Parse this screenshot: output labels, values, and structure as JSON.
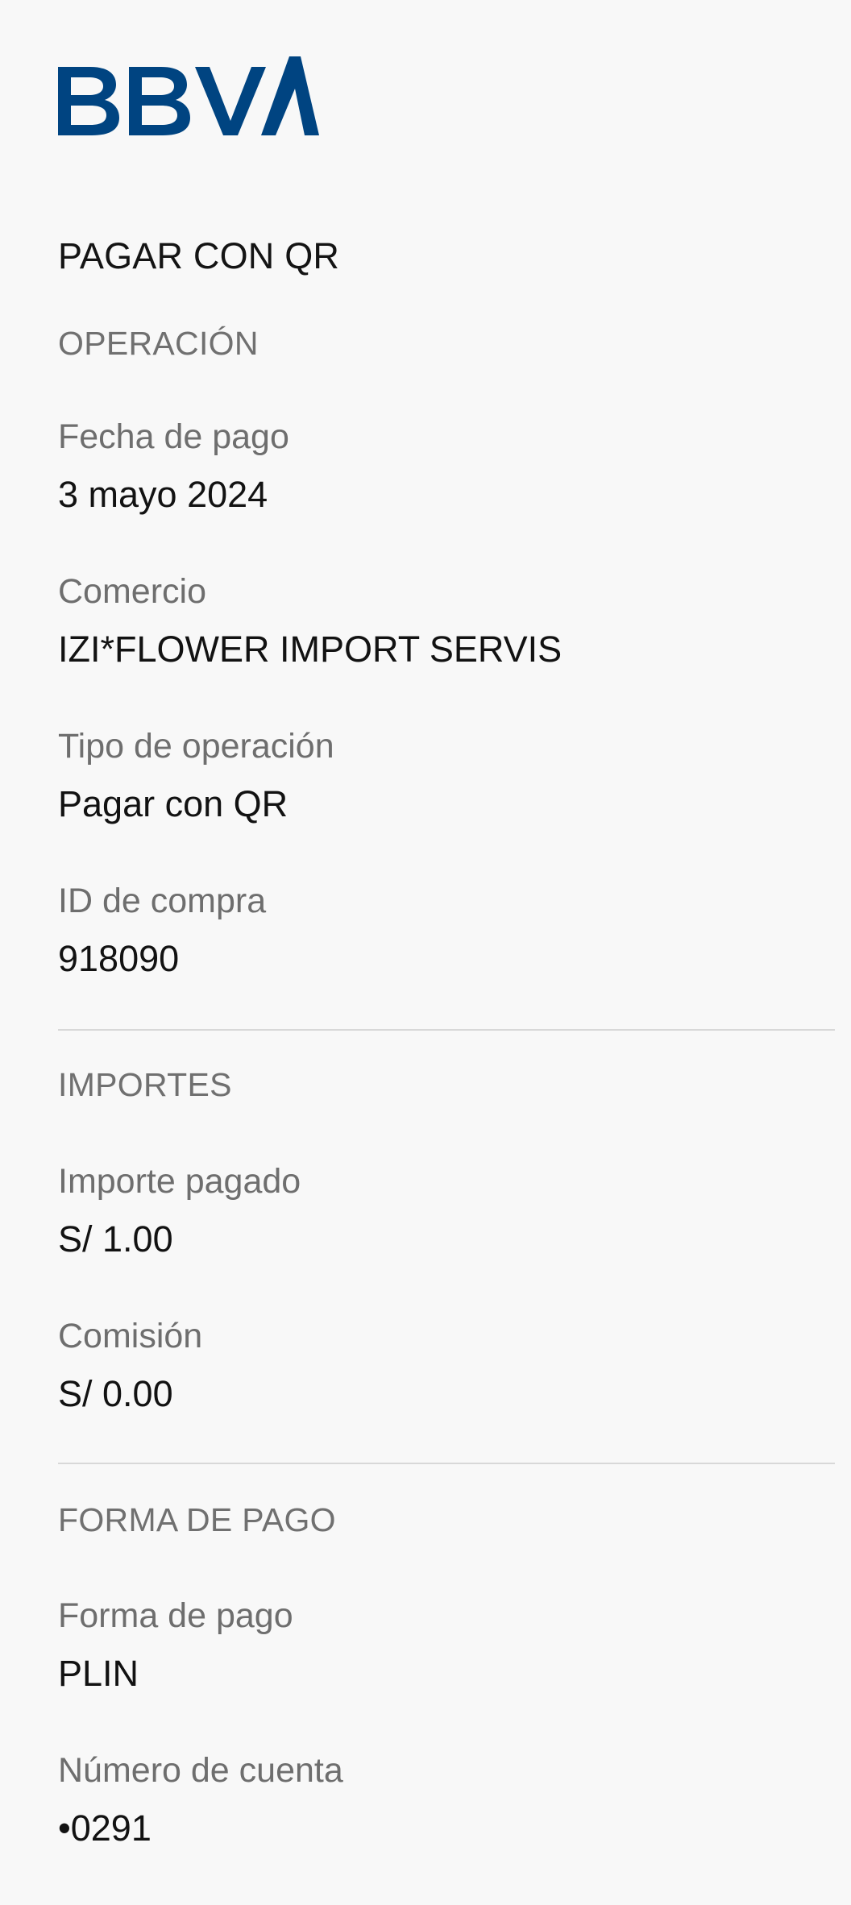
{
  "brand": {
    "logo_text": "BBVA",
    "logo_color": "#004481"
  },
  "header": {
    "title": "PAGAR CON QR"
  },
  "sections": {
    "operation": {
      "title": "OPERACIÓN",
      "fields": [
        {
          "label": "Fecha de pago",
          "value": "3 mayo 2024"
        },
        {
          "label": "Comercio",
          "value": "IZI*FLOWER IMPORT SERVIS"
        },
        {
          "label": "Tipo de operación",
          "value": "Pagar con QR"
        },
        {
          "label": "ID de compra",
          "value": "918090"
        }
      ]
    },
    "amounts": {
      "title": "IMPORTES",
      "fields": [
        {
          "label": "Importe pagado",
          "value": "S/ 1.00"
        },
        {
          "label": "Comisión",
          "value": "S/ 0.00"
        }
      ]
    },
    "payment_method": {
      "title": "FORMA DE PAGO",
      "fields": [
        {
          "label": "Forma de pago",
          "value": "PLIN"
        },
        {
          "label": "Número de cuenta",
          "value": "•0291"
        }
      ]
    }
  }
}
